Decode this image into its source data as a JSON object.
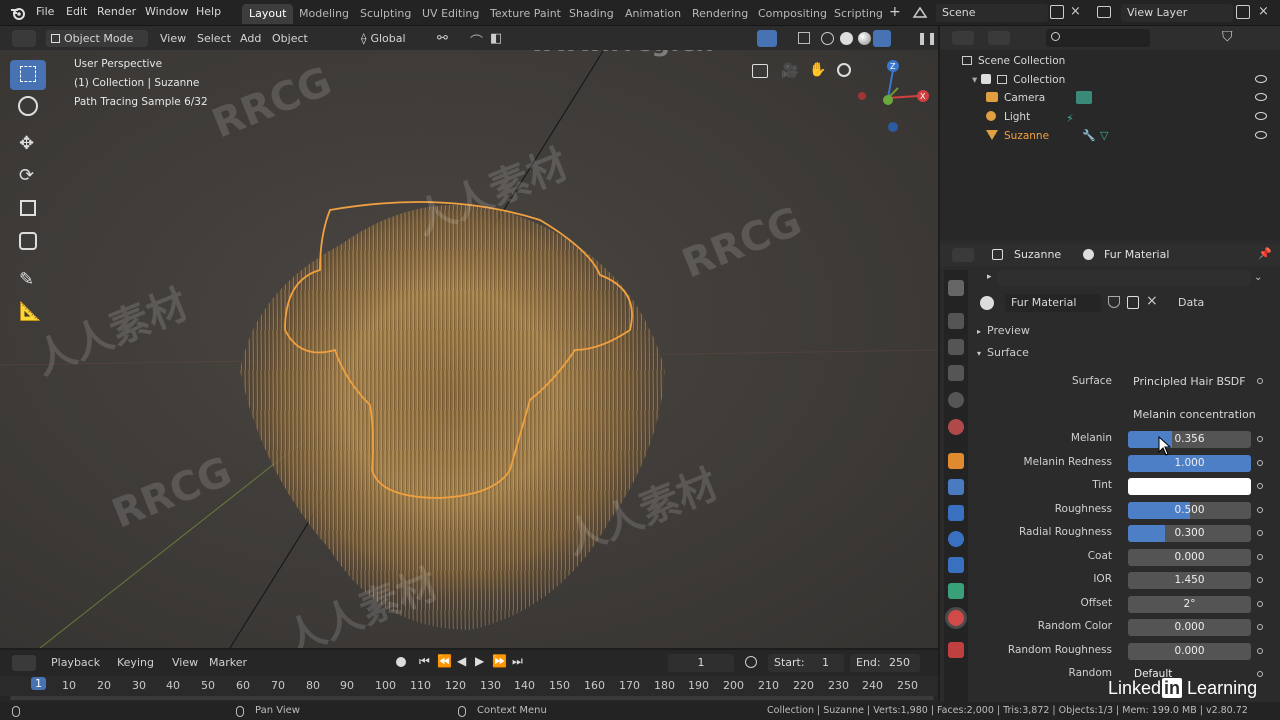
{
  "topbar": {
    "menus": [
      "File",
      "Edit",
      "Render",
      "Window",
      "Help"
    ],
    "workspaces": [
      "Layout",
      "Modeling",
      "Sculpting",
      "UV Editing",
      "Texture Paint",
      "Shading",
      "Animation",
      "Rendering",
      "Compositing",
      "Scripting"
    ],
    "active_workspace": "Layout",
    "scene": "Scene",
    "view_layer": "View Layer"
  },
  "viewport_header": {
    "mode": "Object Mode",
    "menus": [
      "View",
      "Select",
      "Add",
      "Object"
    ],
    "orientation": "Global"
  },
  "viewport": {
    "overlay_lines": [
      "User Perspective",
      "(1) Collection | Suzanne",
      "Path Tracing Sample 6/32"
    ],
    "watermark_url": "www.rrcg.cn",
    "watermark_brand": "RRCG",
    "watermark_cn": "人人素材"
  },
  "outliner": {
    "root": "Scene Collection",
    "collection": "Collection",
    "items": [
      {
        "name": "Camera",
        "color": "#d8d8d8"
      },
      {
        "name": "Light",
        "color": "#d8d8d8"
      },
      {
        "name": "Suzanne",
        "color": "#f0a040"
      }
    ]
  },
  "properties": {
    "object": "Suzanne",
    "material": "Fur Material",
    "slot_material": "Fur Material",
    "link": "Data",
    "preview_label": "Preview",
    "surface_label": "Surface",
    "surface_label_row": "Surface",
    "surface_shader": "Principled Hair BSDF",
    "parametrization": "Melanin concentration",
    "rows": [
      {
        "label": "Melanin",
        "value": "0.356",
        "fill": 0.356
      },
      {
        "label": "Melanin Redness",
        "value": "1.000",
        "fill": 1.0
      },
      {
        "label": "Tint",
        "value": "",
        "fill": 0,
        "color": "#ffffff"
      },
      {
        "label": "Roughness",
        "value": "0.500",
        "fill": 0.5
      },
      {
        "label": "Radial Roughness",
        "value": "0.300",
        "fill": 0.3
      },
      {
        "label": "Coat",
        "value": "0.000",
        "fill": 0
      },
      {
        "label": "IOR",
        "value": "1.450",
        "fill": 0
      },
      {
        "label": "Offset",
        "value": "2°",
        "fill": 0
      },
      {
        "label": "Random Color",
        "value": "0.000",
        "fill": 0
      },
      {
        "label": "Random Roughness",
        "value": "0.000",
        "fill": 0
      },
      {
        "label": "Random",
        "value": "Default",
        "fill": 0
      }
    ]
  },
  "timeline": {
    "menus": [
      "Playback",
      "Keying",
      "View",
      "Marker"
    ],
    "current_frame": "1",
    "start_label": "Start:",
    "start": "1",
    "end_label": "End:",
    "end": "250",
    "ticks": [
      "1",
      "10",
      "20",
      "30",
      "40",
      "50",
      "60",
      "70",
      "80",
      "90",
      "100",
      "110",
      "120",
      "130",
      "140",
      "150",
      "160",
      "170",
      "180",
      "190",
      "200",
      "210",
      "220",
      "230",
      "240",
      "250"
    ]
  },
  "statusbar": {
    "pan": "Pan View",
    "context": "Context Menu",
    "stats": "Collection | Suzanne | Verts:1,980 | Faces:2,000 | Tris:3,872 | Objects:1/3 | Mem: 199.0 MB | v2.80.72"
  },
  "branding": {
    "linkedin_pre": "Linked",
    "linkedin_in": "in",
    "linkedin_post": "Learning"
  },
  "colors": {
    "accent": "#4772b3",
    "field_fill": "#4d7fc7",
    "selection_orange": "#f0a040"
  }
}
